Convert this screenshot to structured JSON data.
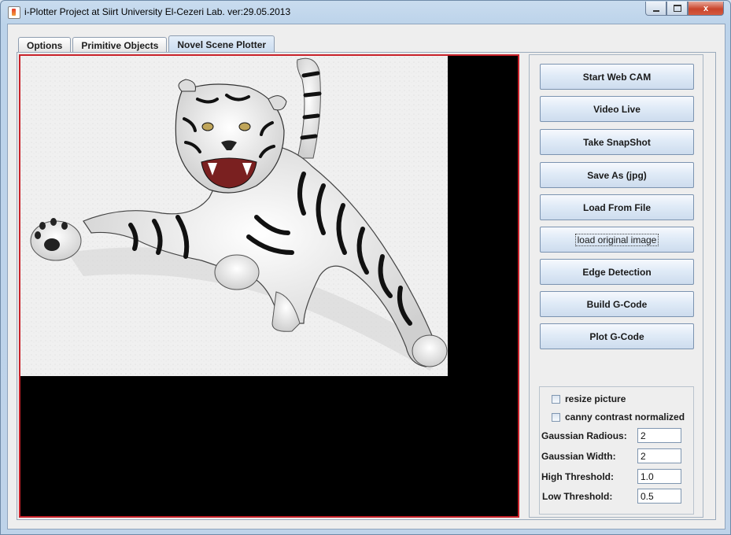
{
  "window": {
    "title": "i-Plotter Project at Siirt University El-Cezeri Lab.  ver:29.05.2013",
    "controls": {
      "close": "x"
    }
  },
  "tabs": [
    {
      "label": "Options",
      "selected": false
    },
    {
      "label": "Primitive Objects",
      "selected": false
    },
    {
      "label": "Novel Scene Plotter",
      "selected": true
    }
  ],
  "buttons": {
    "start_webcam": "Start Web CAM",
    "video_live": "Video Live",
    "take_snapshot": "Take SnapShot",
    "save_as": "Save As (jpg)",
    "load_from_file": "Load From File",
    "load_original": "load original image",
    "edge_detection": "Edge Detection",
    "build_gcode": "Build G-Code",
    "plot_gcode": "Plot G-Code"
  },
  "options": {
    "resize_picture": {
      "label": "resize picture",
      "checked": false
    },
    "canny_normalized": {
      "label": "canny contrast normalized",
      "checked": false
    },
    "gaussian_radius": {
      "label": "Gaussian Radious:",
      "value": "2"
    },
    "gaussian_width": {
      "label": "Gaussian Width:",
      "value": "2"
    },
    "high_threshold": {
      "label": "High Threshold:",
      "value": "1.0"
    },
    "low_threshold": {
      "label": "Low Threshold:",
      "value": "0.5"
    }
  },
  "colors": {
    "image_border": "#c8222a",
    "canvas_background": "#000000",
    "button_gradient_top": "#f6f9fd",
    "button_gradient_bottom": "#cddcee"
  }
}
